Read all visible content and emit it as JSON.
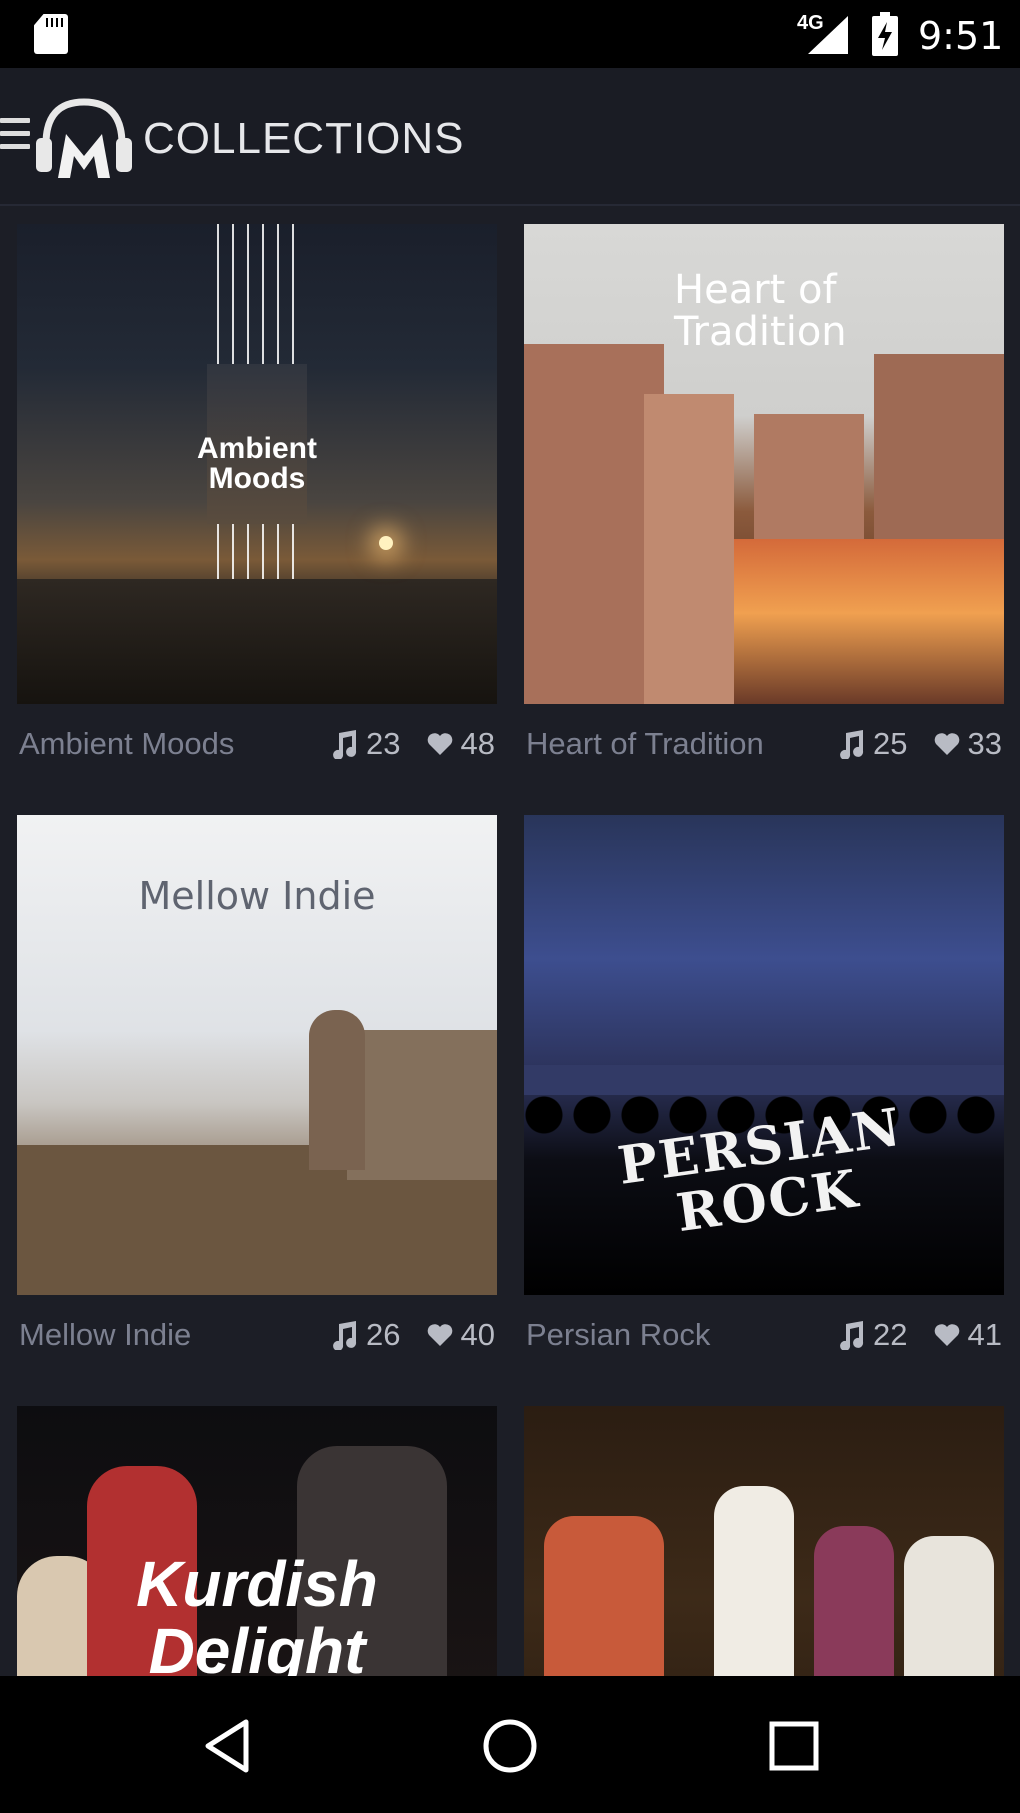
{
  "status_bar": {
    "network": "4G",
    "time": "9:51",
    "icons": [
      "sd-card-icon",
      "signal-icon",
      "battery-charging-icon"
    ]
  },
  "app_bar": {
    "title": "COLLECTIONS",
    "icons": [
      "menu-icon",
      "app-logo-icon"
    ]
  },
  "collections": [
    {
      "name": "Ambient Moods",
      "art_title_line1": "Ambient",
      "art_title_line2": "Moods",
      "tracks": "23",
      "likes": "48"
    },
    {
      "name": "Heart of Tradition",
      "art_title_line1": "Heart of",
      "art_title_line2": "Tradition",
      "tracks": "25",
      "likes": "33"
    },
    {
      "name": "Mellow Indie",
      "art_title_line1": "Mellow Indie",
      "tracks": "26",
      "likes": "40"
    },
    {
      "name": "Persian Rock",
      "art_title_line1": "PERSIAN",
      "art_title_line2": "ROCK",
      "tracks": "22",
      "likes": "41"
    },
    {
      "art_title_line1": "Kurdish",
      "art_title_line2": "Delight"
    },
    {}
  ],
  "stat_icons": [
    "music-note-icon",
    "heart-icon"
  ],
  "nav_bar": {
    "icons": [
      "back-icon",
      "home-icon",
      "recents-icon"
    ]
  }
}
